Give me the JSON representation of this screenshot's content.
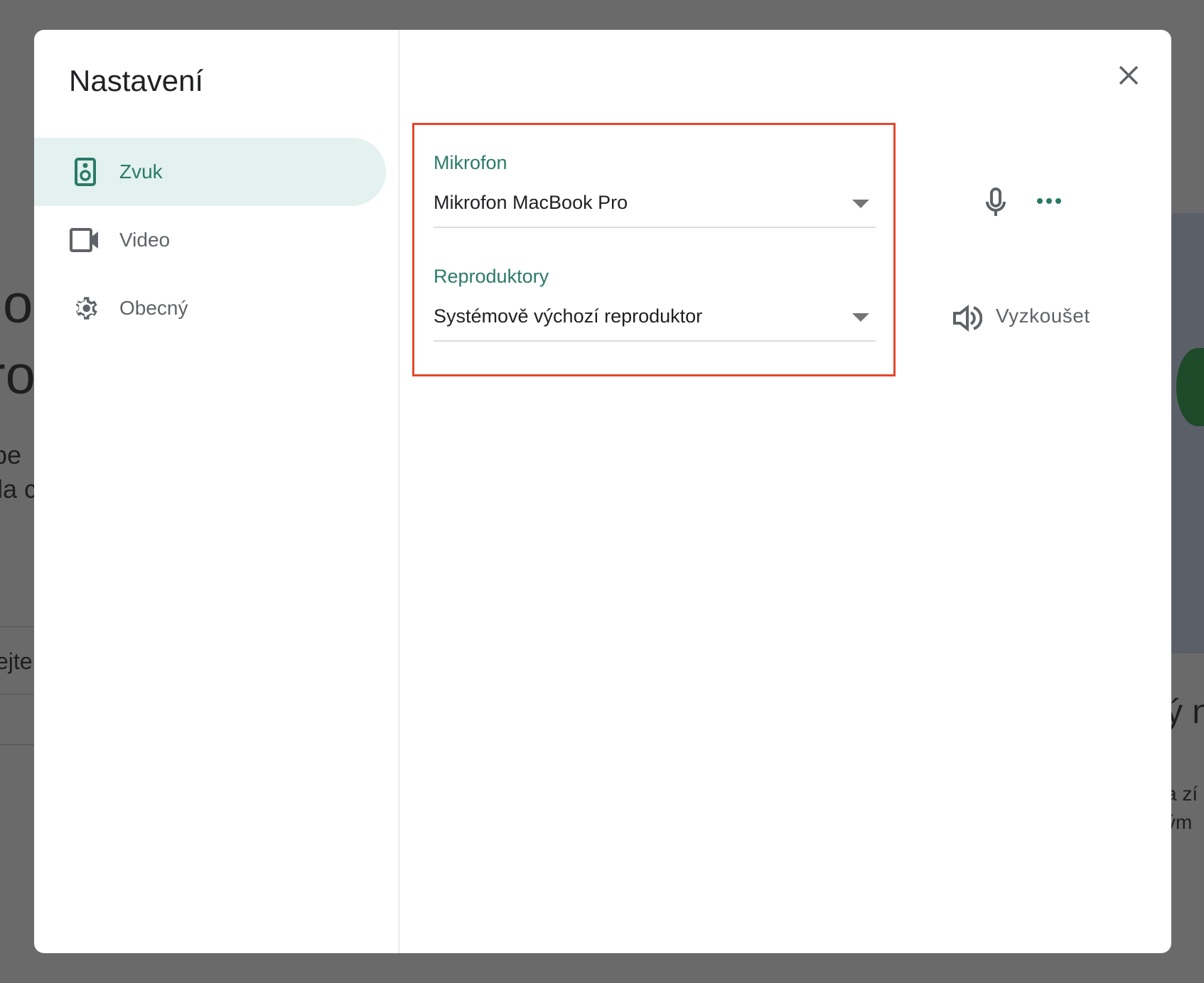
{
  "background": {
    "fragments": [
      "o",
      "pro",
      "be",
      "yla c",
      "ejte",
      "ý n",
      "a zí",
      "ým"
    ]
  },
  "dialog": {
    "title": "Nastavení",
    "nav": [
      {
        "label": "Zvuk",
        "icon": "speaker-icon",
        "active": true
      },
      {
        "label": "Video",
        "icon": "videocam-icon",
        "active": false
      },
      {
        "label": "Obecný",
        "icon": "gear-icon",
        "active": false
      }
    ],
    "microphone": {
      "label": "Mikrofon",
      "value": "Mikrofon MacBook Pro"
    },
    "speakers": {
      "label": "Reproduktory",
      "value": "Systémově výchozí reproduktor",
      "test_label": "Vyzkoušet"
    }
  },
  "colors": {
    "accent": "#2b7a68",
    "highlight_box": "#e8452c",
    "active_nav_bg": "#e3f1ef"
  }
}
